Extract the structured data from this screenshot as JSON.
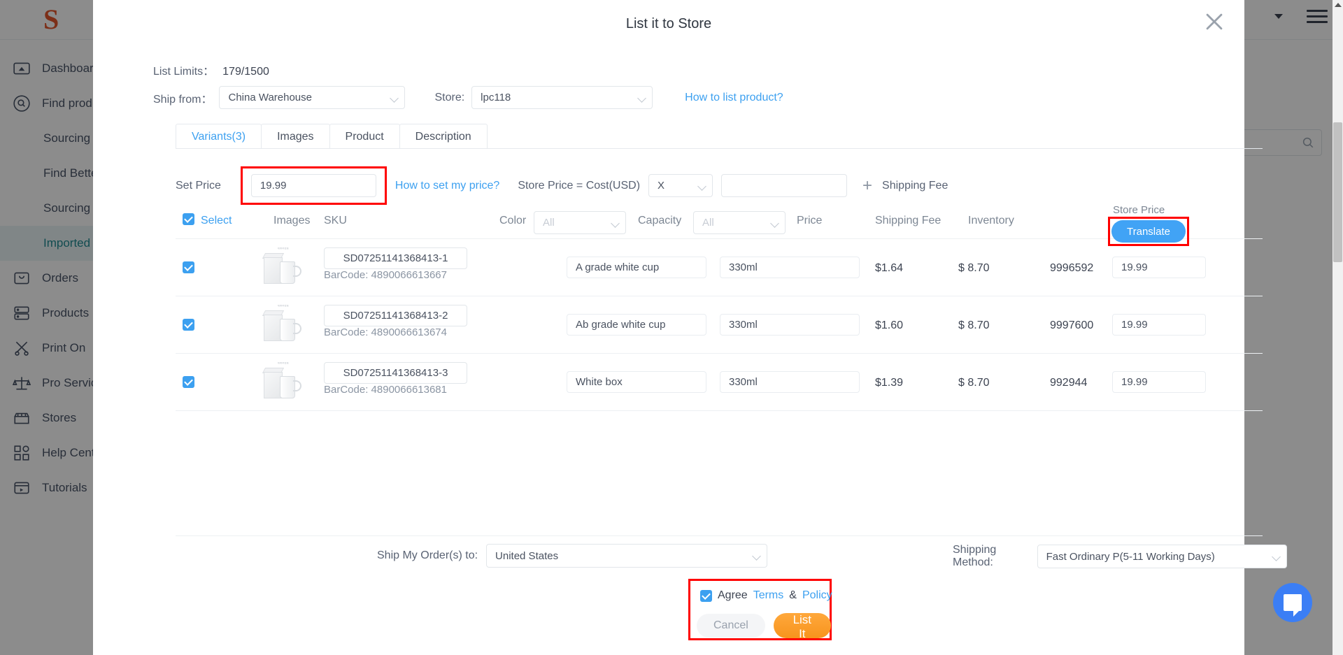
{
  "background": {
    "logo_text": "S",
    "sidebar": {
      "items": [
        {
          "label": "Dashboard",
          "icon": "dashboard-icon",
          "type": "top",
          "active": false
        },
        {
          "label": "Find product",
          "icon": "search-circle-icon",
          "type": "top",
          "active": false
        },
        {
          "label": "Sourcing",
          "icon": "",
          "type": "sub",
          "active": false
        },
        {
          "label": "Find Better",
          "icon": "",
          "type": "sub",
          "active": false
        },
        {
          "label": "Sourcing",
          "icon": "",
          "type": "sub",
          "active": false
        },
        {
          "label": "Imported",
          "icon": "",
          "type": "sub",
          "active": true
        },
        {
          "label": "Orders",
          "icon": "inbox-icon",
          "type": "top",
          "active": false
        },
        {
          "label": "Products",
          "icon": "layers-icon",
          "type": "top",
          "active": false
        },
        {
          "label": "Print On",
          "icon": "scissors-icon",
          "type": "top",
          "active": false
        },
        {
          "label": "Pro Service",
          "icon": "scales-icon",
          "type": "top",
          "active": false
        },
        {
          "label": "Stores",
          "icon": "store-icon",
          "type": "top",
          "active": false
        },
        {
          "label": "Help Center",
          "icon": "grid-icon",
          "type": "top",
          "active": false
        },
        {
          "label": "Tutorials",
          "icon": "video-icon",
          "type": "top",
          "active": false
        }
      ]
    },
    "search_placeholder": ""
  },
  "modal": {
    "title": "List it to Store",
    "close_icon": "close-icon",
    "list_limits_label": "List Limits：",
    "list_limits_value": "179/1500",
    "ship_from_label": "Ship from：",
    "ship_from_value": "China Warehouse",
    "store_label": "Store:",
    "store_value": "lpc118",
    "how_to_list_link": "How to list product?",
    "tabs": [
      {
        "label": "Variants(3)",
        "active": true
      },
      {
        "label": "Images",
        "active": false
      },
      {
        "label": "Product",
        "active": false
      },
      {
        "label": "Description",
        "active": false
      }
    ],
    "set_price": {
      "label": "Set Price",
      "value": "19.99",
      "help_link": "How to set my price?",
      "formula_label": "Store Price = Cost(USD)",
      "operator": "X",
      "multiplier": "",
      "plus": "+",
      "shipping_fee_label": "Shipping Fee"
    },
    "table": {
      "header": {
        "select": "Select",
        "select_checked": true,
        "images": "Images",
        "sku": "SKU",
        "color_label": "Color",
        "color_value": "All",
        "capacity_label": "Capacity",
        "capacity_value": "All",
        "price": "Price",
        "shipping_fee": "Shipping Fee",
        "inventory": "Inventory",
        "store_price": "Store Price",
        "translate_button": "Translate"
      },
      "rows": [
        {
          "checked": true,
          "sku": "SD07251141368413-1",
          "barcode_label": "BarCode:",
          "barcode": "4890066613667",
          "color": "A grade white cup",
          "capacity": "330ml",
          "price": "$1.64",
          "shipping_fee": "$ 8.70",
          "inventory": "9996592",
          "store_price": "19.99",
          "thumb_caption": "喷香杯套装"
        },
        {
          "checked": true,
          "sku": "SD07251141368413-2",
          "barcode_label": "BarCode:",
          "barcode": "4890066613674",
          "color": "Ab grade white cup",
          "capacity": "330ml",
          "price": "$1.60",
          "shipping_fee": "$ 8.70",
          "inventory": "9997600",
          "store_price": "19.99",
          "thumb_caption": "喷香杯套装"
        },
        {
          "checked": true,
          "sku": "SD07251141368413-3",
          "barcode_label": "BarCode:",
          "barcode": "4890066613681",
          "color": "White box",
          "capacity": "330ml",
          "price": "$1.39",
          "shipping_fee": "$ 8.70",
          "inventory": "992944",
          "store_price": "19.99",
          "thumb_caption": "喷香杯套装"
        }
      ]
    },
    "footer": {
      "ship_to_label": "Ship My Order(s) to:",
      "ship_to_value": "United States",
      "shipping_method_label": "Shipping Method:",
      "shipping_method_value": "Fast Ordinary P(5-11 Working Days)",
      "agree_label": "Agree",
      "terms_label": "Terms",
      "amp_label": "&",
      "policy_label": "Policy",
      "agree_checked": true,
      "cancel_button": "Cancel",
      "list_button": "List It Now"
    }
  },
  "colors": {
    "accent_blue": "#3ca0f0",
    "highlight_red": "#ff0000",
    "cta_orange": "#f7941d",
    "active_nav": "#1f8a93",
    "logo_orange": "#e2562c"
  }
}
